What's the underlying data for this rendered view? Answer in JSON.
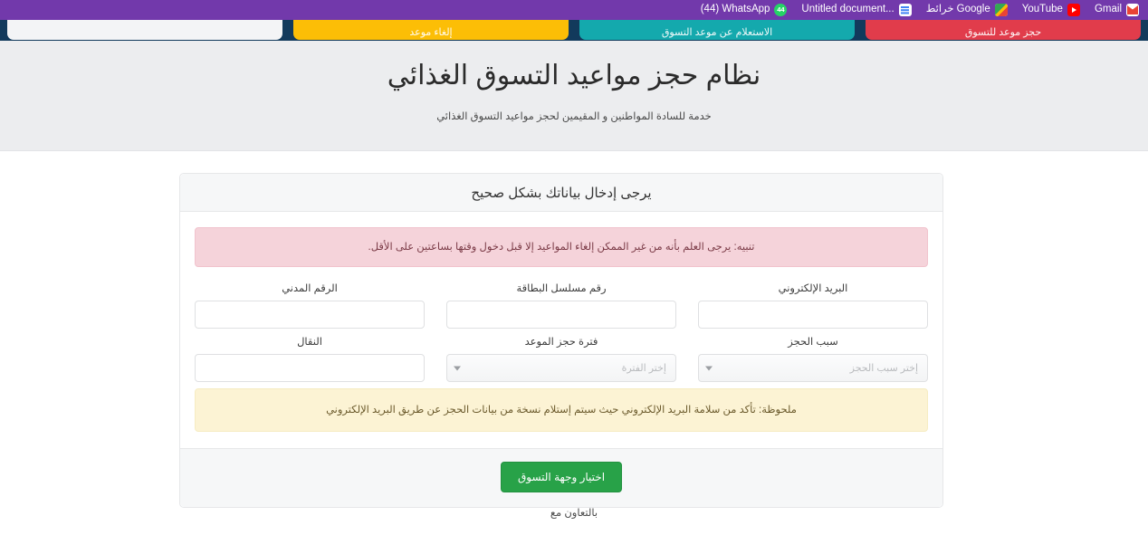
{
  "browser": {
    "chrome_color": "#7239ab",
    "bookmarks": [
      {
        "label": "(44) WhatsApp",
        "icon": "whatsapp-icon"
      },
      {
        "label": "Untitled document...",
        "icon": "google-docs-icon"
      },
      {
        "label": "خرائط Google",
        "icon": "google-maps-icon"
      },
      {
        "label": "YouTube",
        "icon": "youtube-icon"
      },
      {
        "label": "Gmail",
        "icon": "gmail-icon"
      }
    ]
  },
  "site_tabs": {
    "strip_color": "#123a5c",
    "items": [
      {
        "label": "حجز موعد للتسوق",
        "color": "#e13c4b"
      },
      {
        "label": "الاستعلام عن موعد التسوق",
        "color": "#14a9ad"
      },
      {
        "label": "إلغاء موعد",
        "color": "#fcbe06"
      },
      {
        "label": "",
        "color": "#f3f4f6"
      }
    ]
  },
  "header": {
    "title": "نظام حجز مواعيد التسوق الغذائي",
    "subtitle": "خدمة للسادة المواطنين و المقيمين لحجز مواعيد التسوق الغذائي",
    "background": "#ecedef"
  },
  "card": {
    "title": "يرجى إدخال بياناتك بشكل صحيح",
    "alert_danger": "تنبيه: يرجى العلم بأنه من غير الممكن إلغاء المواعيد إلا قبل دخول وقتها بساعتين على الأقل.",
    "alert_warning": "ملحوظة: تأكد من سلامة البريد الإلكتروني حيث سيتم إستلام نسخة من بيانات الحجز عن طريق البريد الإلكتروني",
    "fields": {
      "civil_id": {
        "label": "الرقم المدني",
        "value": "",
        "placeholder": ""
      },
      "card_serial": {
        "label": "رقم مسلسل البطاقة",
        "value": "",
        "placeholder": ""
      },
      "email": {
        "label": "البريد الإلكتروني",
        "value": "",
        "placeholder": ""
      },
      "mobile": {
        "label": "النقال",
        "value": "",
        "placeholder": ""
      },
      "period": {
        "label": "فترة حجز الموعد",
        "value": "إختر الفترة"
      },
      "reason": {
        "label": "سبب الحجز",
        "value": "إختر سبب الحجز"
      }
    },
    "submit_label": "اختيار وجهة التسوق",
    "submit_color": "#28a248"
  },
  "footer": {
    "note": "بالتعاون مع"
  }
}
